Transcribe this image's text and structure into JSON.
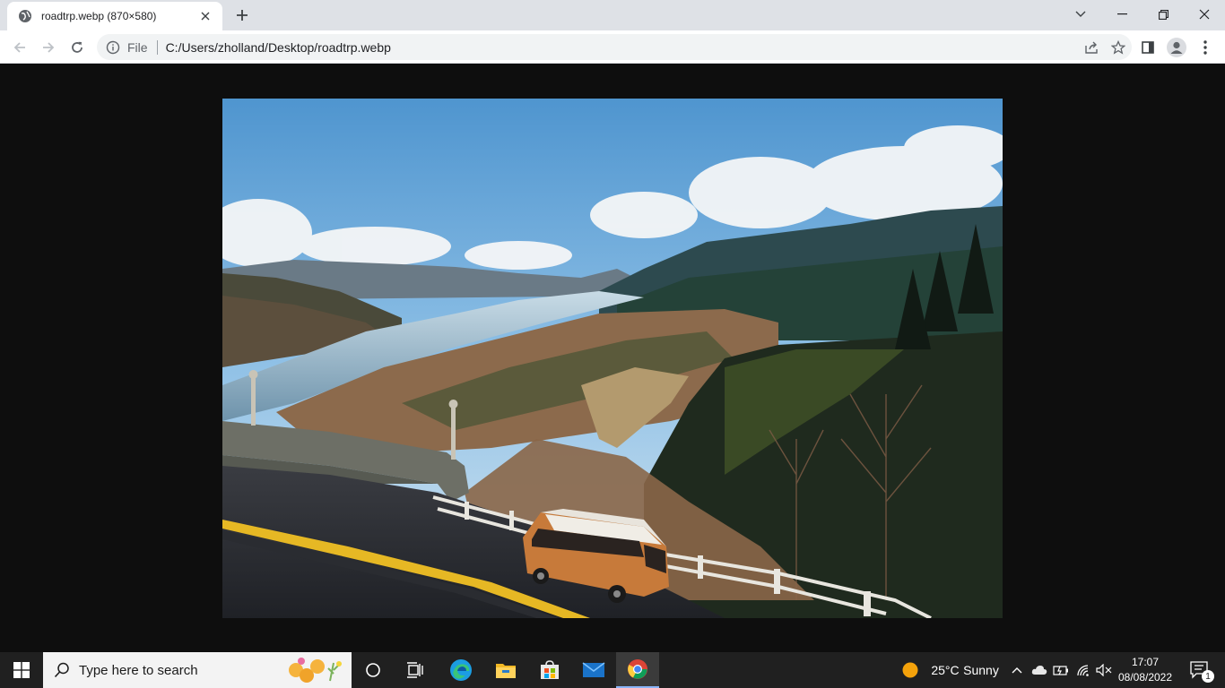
{
  "browser": {
    "tab_title": "roadtrp.webp (870×580)",
    "file_label": "File",
    "url": "C:/Users/zholland/Desktop/roadtrp.webp"
  },
  "image": {
    "filename": "roadtrp.webp",
    "width": 870,
    "height": 580,
    "alt": "Orange van driving on a curving road above a river valley with mountains"
  },
  "taskbar": {
    "search_placeholder": "Type here to search",
    "weather_temp": "25°C",
    "weather_cond": "Sunny",
    "time": "17:07",
    "date": "08/08/2022",
    "notification_count": "1"
  },
  "colors": {
    "accent_chrome": "#1a73e8",
    "taskbar_bg": "#202020",
    "weather_sun": "#f4a20b"
  }
}
